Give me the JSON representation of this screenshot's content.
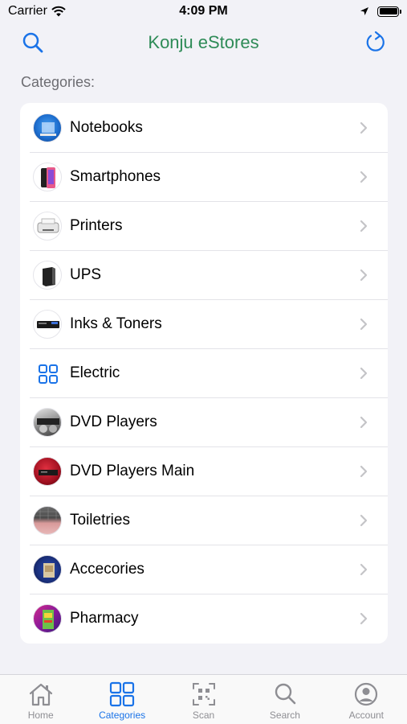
{
  "status_bar": {
    "carrier": "Carrier",
    "time": "4:09 PM"
  },
  "nav": {
    "title": "Konju eStores"
  },
  "section_header": "Categories:",
  "categories": [
    {
      "label": "Notebooks"
    },
    {
      "label": "Smartphones"
    },
    {
      "label": "Printers"
    },
    {
      "label": "UPS"
    },
    {
      "label": "Inks & Toners"
    },
    {
      "label": "Electric"
    },
    {
      "label": "DVD Players"
    },
    {
      "label": "DVD Players Main"
    },
    {
      "label": "Toiletries"
    },
    {
      "label": "Accecories"
    },
    {
      "label": "Pharmacy"
    }
  ],
  "tabs": [
    {
      "label": "Home",
      "icon": "home-icon"
    },
    {
      "label": "Categories",
      "icon": "grid-icon",
      "active": true
    },
    {
      "label": "Scan",
      "icon": "qr-scan-icon"
    },
    {
      "label": "Search",
      "icon": "search-icon"
    },
    {
      "label": "Account",
      "icon": "account-icon"
    }
  ],
  "colors": {
    "accent": "#1a73e8",
    "title": "#2e8b57",
    "background": "#f2f2f7"
  }
}
